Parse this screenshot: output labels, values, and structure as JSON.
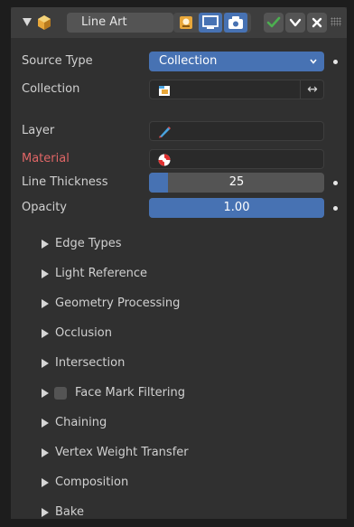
{
  "header": {
    "modifier_name": "Line Art",
    "icons": [
      "collapse-triangle-icon",
      "line-art-modifier-icon",
      "show-in-edit-mode-icon",
      "show-in-viewport-icon",
      "show-in-render-icon",
      "apply-checkmark-icon",
      "dropdown-chevron-icon",
      "remove-x-icon",
      "drag-grip-icon"
    ],
    "accent_color": "#4772b3",
    "check_color": "#4caf50"
  },
  "properties": {
    "source_type": {
      "label": "Source Type",
      "value": "Collection"
    },
    "collection": {
      "label": "Collection",
      "value": "",
      "swap_glyph": "↔"
    },
    "layer": {
      "label": "Layer",
      "value": ""
    },
    "material": {
      "label": "Material",
      "value": "",
      "label_color": "#e06666"
    },
    "line_thickness": {
      "label": "Line Thickness",
      "value": "25",
      "fill": 0.11
    },
    "opacity": {
      "label": "Opacity",
      "value": "1.00",
      "fill": 1.0
    }
  },
  "subpanels": [
    {
      "label": "Edge Types"
    },
    {
      "label": "Light Reference"
    },
    {
      "label": "Geometry Processing"
    },
    {
      "label": "Occlusion"
    },
    {
      "label": "Intersection"
    },
    {
      "label": "Face Mark Filtering",
      "checkbox": true
    },
    {
      "label": "Chaining"
    },
    {
      "label": "Vertex Weight Transfer"
    },
    {
      "label": "Composition"
    },
    {
      "label": "Bake"
    }
  ]
}
